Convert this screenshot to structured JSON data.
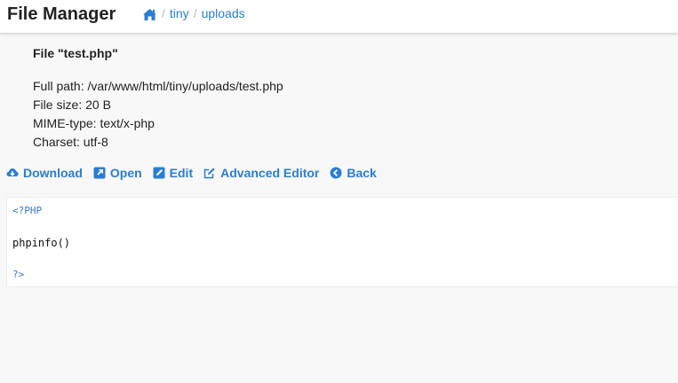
{
  "app": {
    "title": "File Manager"
  },
  "breadcrumb": {
    "home_icon": "home-icon",
    "separator": "/",
    "items": [
      "tiny",
      "uploads"
    ]
  },
  "file": {
    "title": "File \"test.php\"",
    "full_path": "Full path: /var/www/html/tiny/uploads/test.php",
    "size": "File size: 20 B",
    "mime": "MIME-type: text/x-php",
    "charset": "Charset: utf-8"
  },
  "actions": {
    "download": "Download",
    "open": "Open",
    "edit": "Edit",
    "advanced_editor": "Advanced Editor",
    "back": "Back"
  },
  "code": {
    "lines": [
      "<?PHP",
      "",
      "phpinfo()",
      "",
      "?>"
    ]
  },
  "colors": {
    "link": "#2a7dd6",
    "php_tag": "#3877c7",
    "background": "#f8f8f8"
  }
}
